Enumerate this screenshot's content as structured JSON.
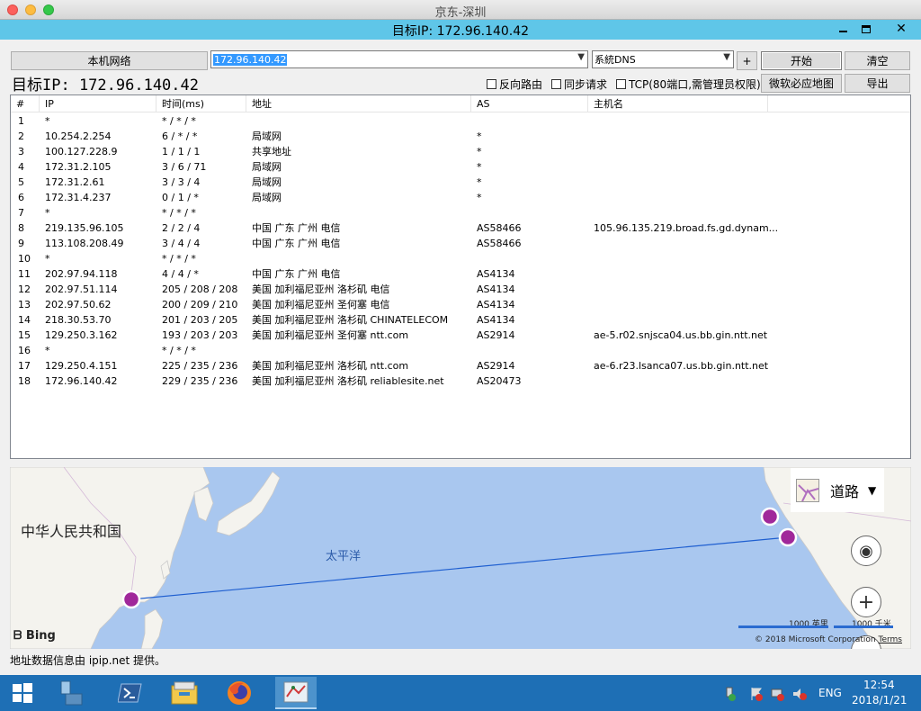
{
  "mac_window": {
    "title": "京东-深圳"
  },
  "app": {
    "title": "目标IP: 172.96.140.42"
  },
  "toolbar": {
    "local_network_label": "本机网络",
    "target_input_value": "172.96.140.42",
    "dns_select_value": "系統DNS",
    "add_label": "+",
    "start_label": "开始",
    "clear_label": "清空",
    "bing_map_label": "微软必应地图",
    "export_label": "导出"
  },
  "target_display": "目标IP: 172.96.140.42",
  "options": {
    "reverse_route": "反向路由",
    "sync_request": "同步请求",
    "tcp": "TCP(80端口,需管理员权限)"
  },
  "table": {
    "columns": [
      "#",
      "IP",
      "时间(ms)",
      "地址",
      "AS",
      "主机名"
    ],
    "rows": [
      [
        "1",
        "*",
        "* / * / *",
        "",
        "",
        ""
      ],
      [
        "2",
        "10.254.2.254",
        "6 / * / *",
        "局域网",
        "*",
        ""
      ],
      [
        "3",
        "100.127.228.9",
        "1 / 1 / 1",
        "共享地址",
        "*",
        ""
      ],
      [
        "4",
        "172.31.2.105",
        "3 / 6 / 71",
        "局域网",
        "*",
        ""
      ],
      [
        "5",
        "172.31.2.61",
        "3 / 3 / 4",
        "局域网",
        "*",
        ""
      ],
      [
        "6",
        "172.31.4.237",
        "0 / 1 / *",
        "局域网",
        "*",
        ""
      ],
      [
        "7",
        "*",
        "* / * / *",
        "",
        "",
        ""
      ],
      [
        "8",
        "219.135.96.105",
        "2 / 2 / 4",
        "中国 广东 广州 电信",
        "AS58466",
        "105.96.135.219.broad.fs.gd.dynam..."
      ],
      [
        "9",
        "113.108.208.49",
        "3 / 4 / 4",
        "中国 广东 广州 电信",
        "AS58466",
        ""
      ],
      [
        "10",
        "*",
        "* / * / *",
        "",
        "",
        ""
      ],
      [
        "11",
        "202.97.94.118",
        "4 / 4 / *",
        "中国 广东 广州 电信",
        "AS4134",
        ""
      ],
      [
        "12",
        "202.97.51.114",
        "205 / 208 / 208",
        "美国 加利福尼亚州 洛杉矶 电信",
        "AS4134",
        ""
      ],
      [
        "13",
        "202.97.50.62",
        "200 / 209 / 210",
        "美国 加利福尼亚州 圣何塞 电信",
        "AS4134",
        ""
      ],
      [
        "14",
        "218.30.53.70",
        "201 / 203 / 205",
        "美国 加利福尼亚州 洛杉矶 CHINATELECOM",
        "AS4134",
        ""
      ],
      [
        "15",
        "129.250.3.162",
        "193 / 203 / 203",
        "美国 加利福尼亚州 圣何塞 ntt.com",
        "AS2914",
        "ae-5.r02.snjsca04.us.bb.gin.ntt.net"
      ],
      [
        "16",
        "*",
        "* / * / *",
        "",
        "",
        ""
      ],
      [
        "17",
        "129.250.4.151",
        "225 / 235 / 236",
        "美国 加利福尼亚州 洛杉矶 ntt.com",
        "AS2914",
        "ae-6.r23.lsanca07.us.bb.gin.ntt.net"
      ],
      [
        "18",
        "172.96.140.42",
        "229 / 235 / 236",
        "美国 加利福尼亚州 洛杉矶 reliablesite.net",
        "AS20473",
        ""
      ]
    ]
  },
  "map": {
    "country_label": "中华人民共和国",
    "ocean_label": "太平洋",
    "style_label": "道路",
    "scale_miles": "1000 英里",
    "scale_km": "1000 千米",
    "bing_label": "Bing",
    "copyright": "© 2018 Microsoft Corporation",
    "terms": "Terms",
    "route_color": "#1f5fd0",
    "marker_color": "#a0289a"
  },
  "status": "地址数据信息由 ipip.net 提供。",
  "taskbar": {
    "language": "ENG",
    "time": "12:54",
    "date": "2018/1/21",
    "icons": [
      "windows-start-icon",
      "server-manager-icon",
      "powershell-icon",
      "file-explorer-icon",
      "firefox-icon",
      "besttrace-icon"
    ]
  }
}
